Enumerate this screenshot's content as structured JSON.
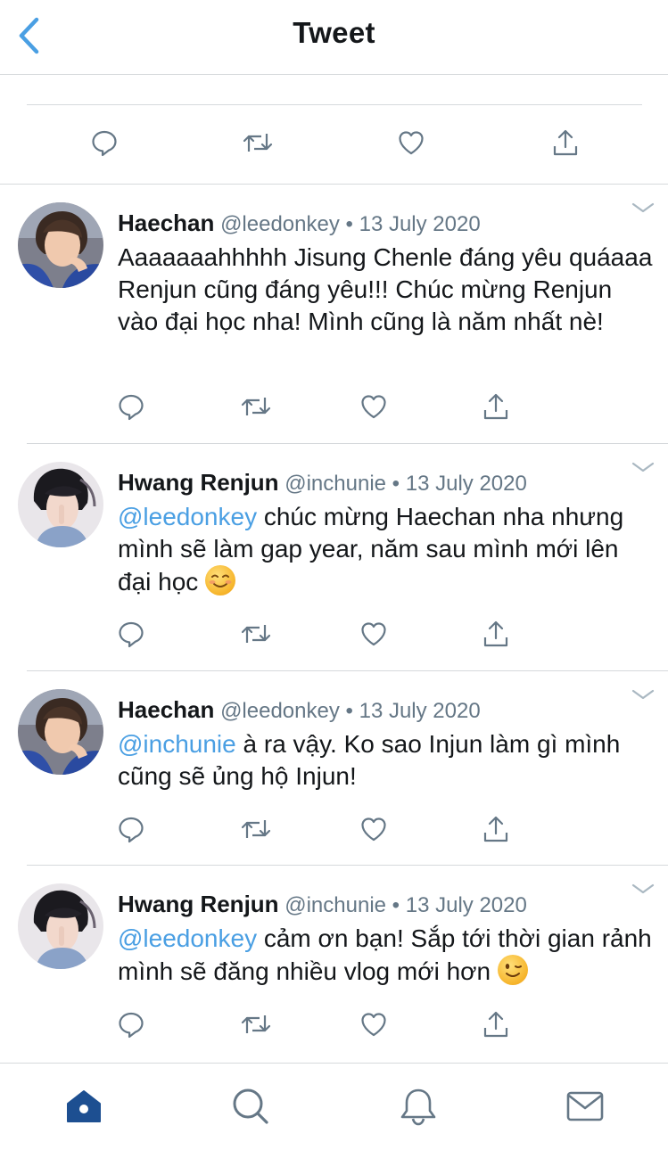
{
  "header": {
    "title": "Tweet",
    "back_icon": "chevron-left-icon"
  },
  "colors": {
    "accent": "#4a9fe3",
    "icon_gray": "#657786",
    "tab_active": "#1d4f91"
  },
  "replies": [
    {
      "name": "Haechan",
      "handle": "@leedonkey",
      "date": "13 July 2020",
      "mention": "",
      "text": "Aaaaaaahhhhh Jisung Chenle đáng yêu quáaaa Renjun cũng đáng yêu!!! Chúc mừng Renjun vào đại học nha! Mình cũng là năm nhất nè!"
    },
    {
      "name": "Hwang Renjun",
      "handle": "@inchunie",
      "date": "13 July 2020",
      "mention": "@leedonkey",
      "text": " chúc mừng Haechan nha nhưng mình sẽ làm gap year, năm sau mình mới lên đại học "
    },
    {
      "name": "Haechan",
      "handle": "@leedonkey",
      "date": "13 July 2020",
      "mention": "@inchunie",
      "text": " à ra vậy. Ko sao Injun làm gì mình cũng sẽ ủng hộ Injun!"
    },
    {
      "name": "Hwang Renjun",
      "handle": "@inchunie",
      "date": "13 July 2020",
      "mention": "@leedonkey",
      "text": " cảm ơn bạn! Sắp tới thời gian rảnh mình sẽ đăng nhiều vlog mới hơn "
    }
  ],
  "separator": "•",
  "tabbar": {
    "items": [
      "home-icon",
      "search-icon",
      "notifications-icon",
      "messages-icon"
    ],
    "active": "home-icon"
  }
}
